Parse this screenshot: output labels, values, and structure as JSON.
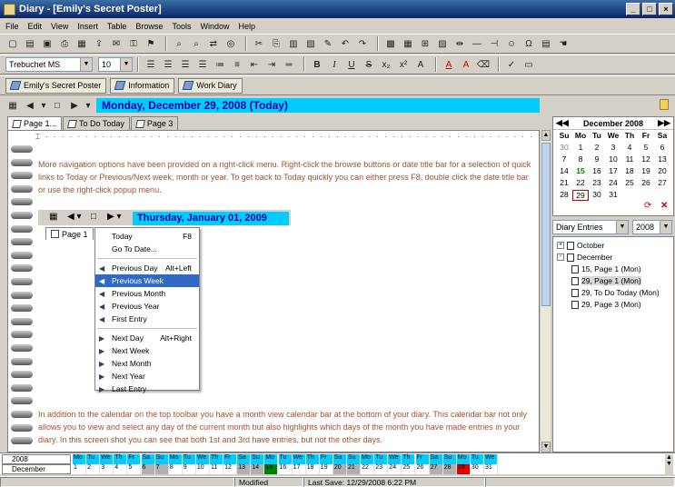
{
  "window": {
    "title": "Diary - [Emily's Secret Poster]"
  },
  "menu": [
    "File",
    "Edit",
    "View",
    "Insert",
    "Table",
    "Browse",
    "Tools",
    "Window",
    "Help"
  ],
  "format": {
    "font": "Trebuchet MS",
    "size": "10"
  },
  "diaries": [
    "Emily's Secret Poster",
    "Information",
    "Work Diary"
  ],
  "date_title": "Monday, December 29, 2008 (Today)",
  "page_tabs": [
    "Page 1...",
    "To Do Today",
    "Page 3"
  ],
  "text1": "More navigation options have been provided on a right-click menu. Right-click the browse buttons or date title bar for a selection of quick links to Today or Previous/Next week, month or year. To get back to Today quickly you can either press F8, double click the date title bar or use the right-click popup menu.",
  "inner": {
    "date_title": "Thursday, January 01, 2009",
    "page_tab": "Page 1"
  },
  "context_menu": [
    {
      "label": "Today",
      "accel": "F8"
    },
    {
      "label": "Go To Date..."
    },
    {
      "sep": true
    },
    {
      "label": "Previous Day",
      "accel": "Alt+Left"
    },
    {
      "label": "Previous Week",
      "selected": true
    },
    {
      "label": "Previous Month"
    },
    {
      "label": "Previous Year"
    },
    {
      "label": "First Entry"
    },
    {
      "sep": true
    },
    {
      "label": "Next Day",
      "accel": "Alt+Right"
    },
    {
      "label": "Next Week"
    },
    {
      "label": "Next Month"
    },
    {
      "label": "Next Year"
    },
    {
      "label": "Last Entry"
    }
  ],
  "text2": "In addition to the calendar on the top toolbar you have a month view calendar bar at the bottom of your diary. This calendar bar not only allows you to view and select any day of the current month but also highlights which days of the month you have made entries in your diary. In this screen shot you can see that both 1st and 3rd have entries, but not the other days.",
  "calendar": {
    "month": "December 2008",
    "days": [
      "Su",
      "Mo",
      "Tu",
      "We",
      "Th",
      "Fr",
      "Sa"
    ],
    "weeks": [
      [
        {
          "d": "30",
          "g": true
        },
        {
          "d": "1"
        },
        {
          "d": "2"
        },
        {
          "d": "3"
        },
        {
          "d": "4"
        },
        {
          "d": "5"
        },
        {
          "d": "6"
        }
      ],
      [
        {
          "d": "7"
        },
        {
          "d": "8"
        },
        {
          "d": "9"
        },
        {
          "d": "10"
        },
        {
          "d": "11"
        },
        {
          "d": "12"
        },
        {
          "d": "13"
        }
      ],
      [
        {
          "d": "14"
        },
        {
          "d": "15",
          "b": true
        },
        {
          "d": "16"
        },
        {
          "d": "17"
        },
        {
          "d": "18"
        },
        {
          "d": "19"
        },
        {
          "d": "20"
        }
      ],
      [
        {
          "d": "21"
        },
        {
          "d": "22"
        },
        {
          "d": "23"
        },
        {
          "d": "24"
        },
        {
          "d": "25"
        },
        {
          "d": "26"
        },
        {
          "d": "27"
        }
      ],
      [
        {
          "d": "28"
        },
        {
          "d": "29",
          "today": true
        },
        {
          "d": "30"
        },
        {
          "d": "31"
        },
        {
          "d": ""
        },
        {
          "d": ""
        },
        {
          "d": ""
        }
      ]
    ]
  },
  "entries_filter": "Diary Entries",
  "entries_year": "2008",
  "tree": [
    {
      "label": "October",
      "level": 0,
      "exp": "+"
    },
    {
      "label": "December",
      "level": 0,
      "exp": "-"
    },
    {
      "label": "15, Page 1 (Mon)",
      "level": 1
    },
    {
      "label": "29, Page 1 (Mon)",
      "level": 1,
      "sel": true
    },
    {
      "label": "29, To Do Today (Mon)",
      "level": 1
    },
    {
      "label": "29, Page 3 (Mon)",
      "level": 1
    }
  ],
  "monthbar": {
    "year": "2008",
    "month": "December",
    "dows": [
      "Mo",
      "Tu",
      "We",
      "Th",
      "Fr",
      "Sa",
      "Su",
      "Mo",
      "Tu",
      "We",
      "Th",
      "Fr",
      "Sa",
      "Su",
      "Mo",
      "Tu",
      "We",
      "Th",
      "Fr",
      "Sa",
      "Su",
      "Mo",
      "Tu",
      "We",
      "Th",
      "Fr",
      "Sa",
      "Su",
      "Mo",
      "Tu",
      "We"
    ],
    "entries": [
      15,
      29
    ]
  },
  "status": {
    "modified": "Modified",
    "saved": "Last Save: 12/29/2008 6:22 PM"
  },
  "colors": {
    "date_bar": "#00ccff",
    "title_bar": "#0a246a",
    "text": "#a0522d",
    "entry_green": "#008000",
    "entry_red": "#e00000"
  }
}
